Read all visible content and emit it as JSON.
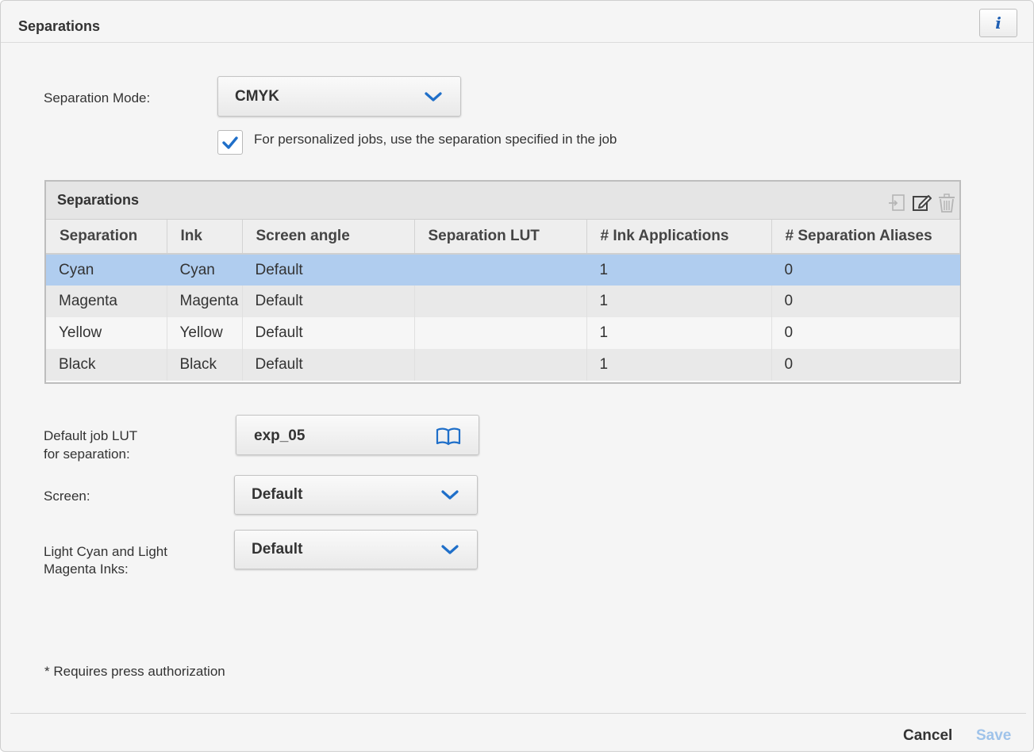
{
  "header": {
    "title": "Separations",
    "info_label": "i"
  },
  "separation_mode": {
    "label": "Separation Mode:",
    "value": "CMYK"
  },
  "personalized": {
    "checked": true,
    "label": "For personalized jobs, use the separation specified in the job"
  },
  "grid": {
    "title": "Separations",
    "tools": [
      "add-icon",
      "edit-icon",
      "delete-icon"
    ],
    "columns": [
      "Separation",
      "Ink",
      "Screen angle",
      "Separation LUT",
      "# Ink Applications",
      "# Separation Aliases"
    ],
    "rows": [
      {
        "separation": "Cyan",
        "ink": "Cyan",
        "screen_angle": "Default",
        "lut": "",
        "ink_apps": "1",
        "aliases": "0",
        "selected": true
      },
      {
        "separation": "Magenta",
        "ink": "Magenta",
        "screen_angle": "Default",
        "lut": "",
        "ink_apps": "1",
        "aliases": "0",
        "selected": false
      },
      {
        "separation": "Yellow",
        "ink": "Yellow",
        "screen_angle": "Default",
        "lut": "",
        "ink_apps": "1",
        "aliases": "0",
        "selected": false
      },
      {
        "separation": "Black",
        "ink": "Black",
        "screen_angle": "Default",
        "lut": "",
        "ink_apps": "1",
        "aliases": "0",
        "selected": false
      }
    ]
  },
  "default_lut": {
    "label_line1": "Default job LUT",
    "label_line2": "for separation:",
    "value": "exp_05"
  },
  "screen": {
    "label": "Screen:",
    "value": "Default"
  },
  "light_inks": {
    "label_line1": "Light Cyan and Light",
    "label_line2": "Magenta Inks:",
    "value": "Default"
  },
  "note": "* Requires press authorization",
  "footer": {
    "cancel": "Cancel",
    "save": "Save"
  },
  "colors": {
    "accent": "#1f6fc9",
    "selection": "#b0cdef",
    "save_disabled": "#9fc3ea"
  }
}
